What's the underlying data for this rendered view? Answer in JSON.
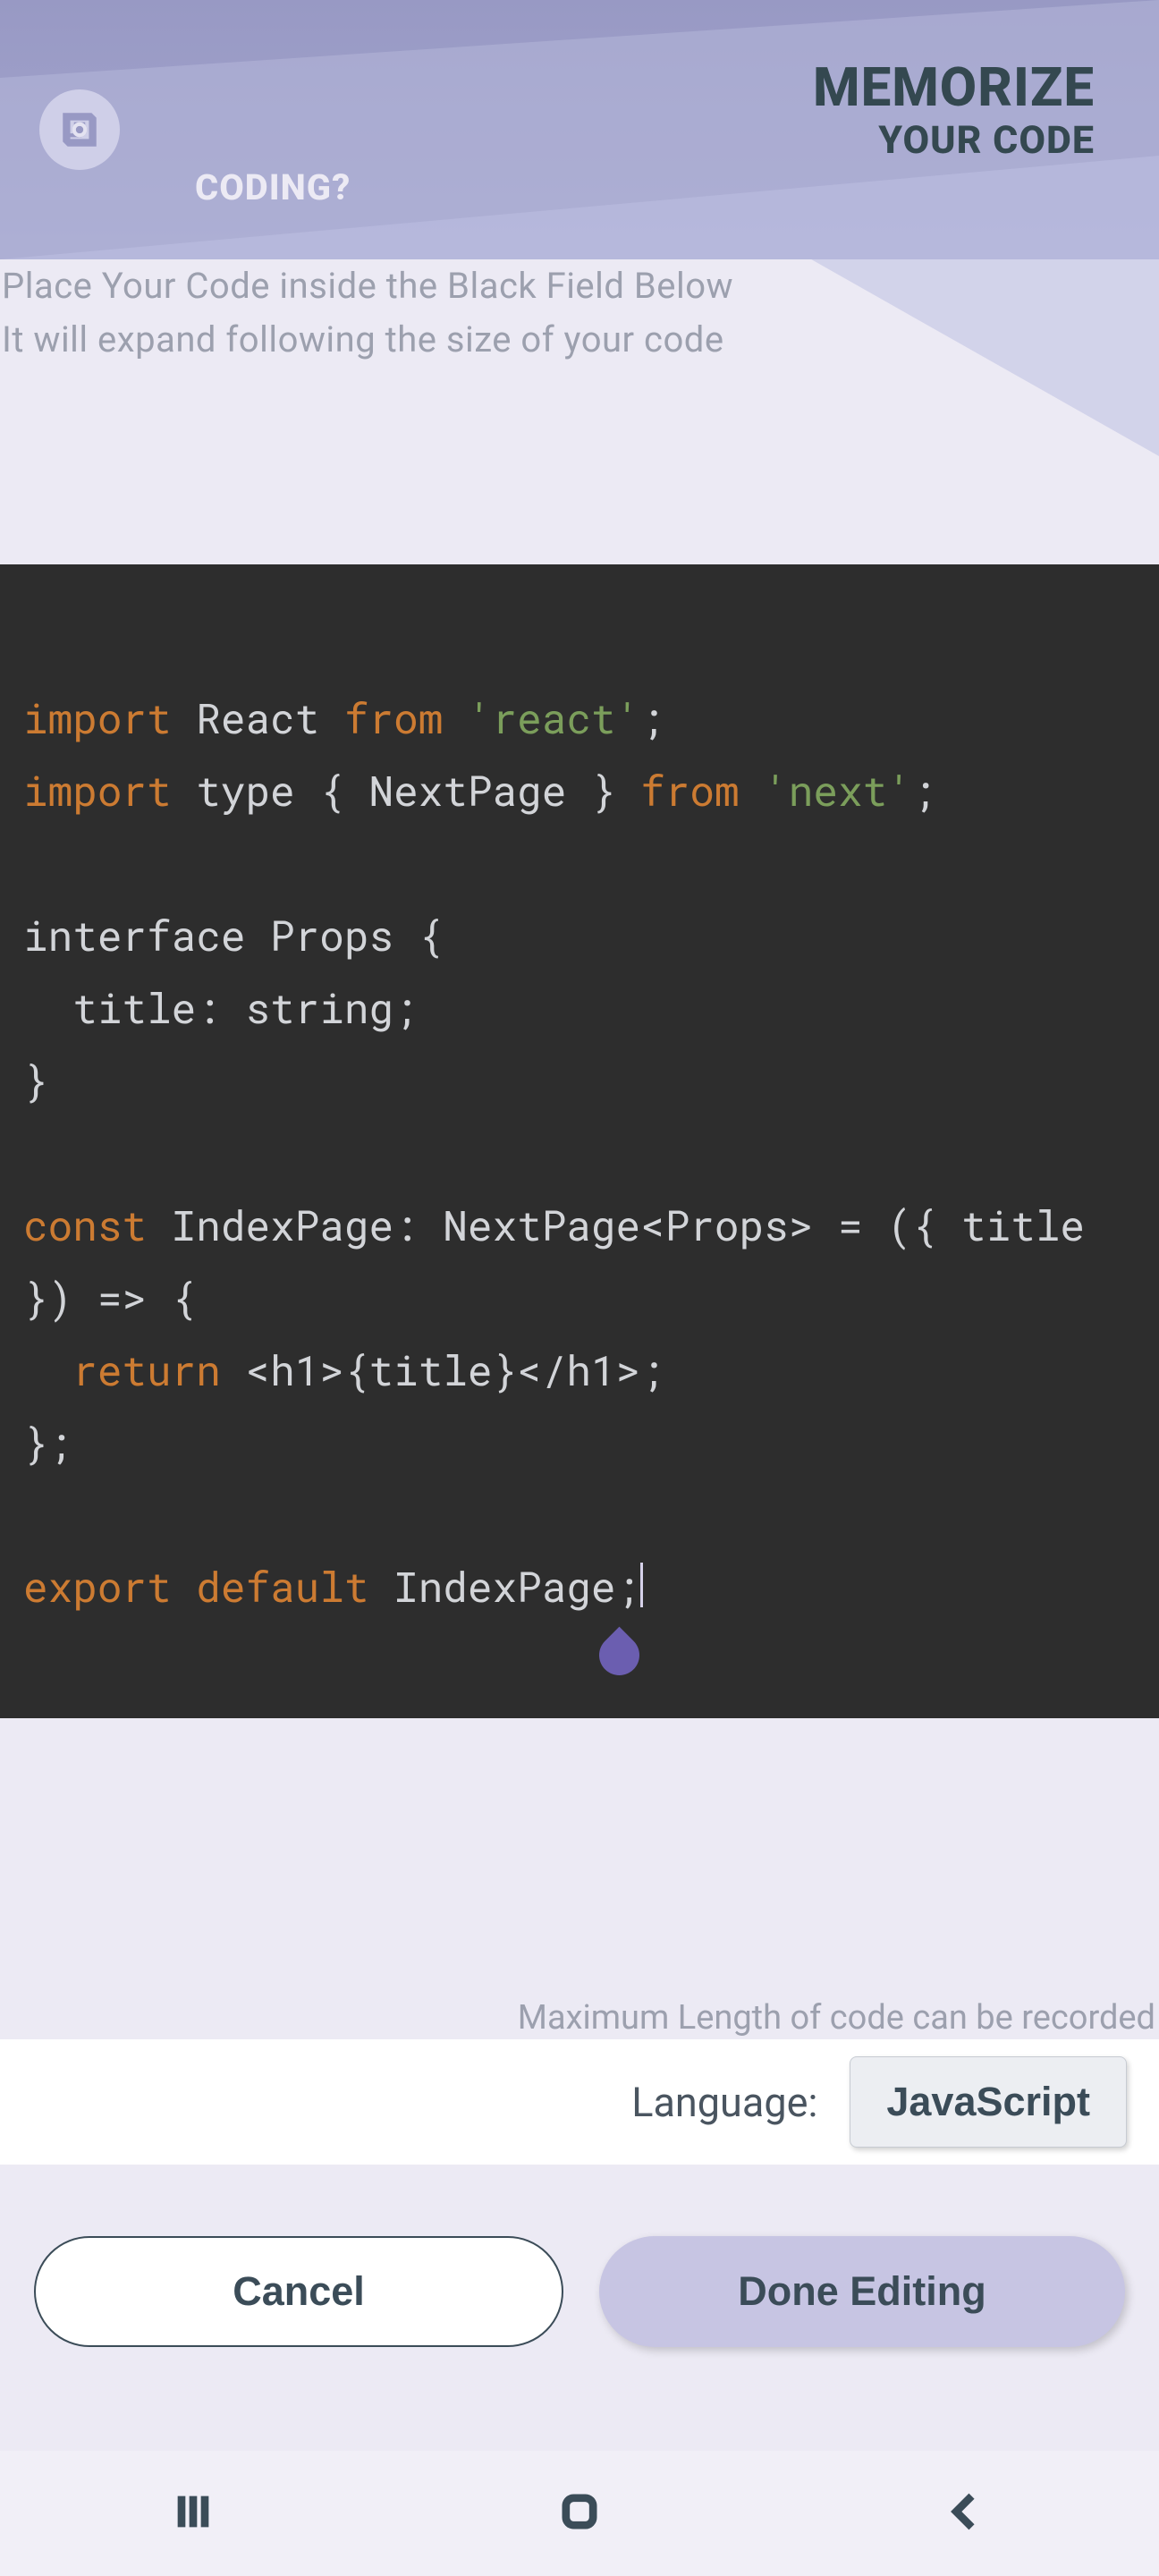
{
  "header": {
    "brand_question": "CODING?",
    "title_line1": "MEMORIZE",
    "title_line2": "YOUR CODE"
  },
  "hints": {
    "line1": "Place Your Code inside the Black Field Below",
    "line2": "It will expand following the size of your code"
  },
  "code": {
    "tokens": [
      {
        "t": "kw",
        "v": "import"
      },
      {
        "t": "txt",
        "v": " React "
      },
      {
        "t": "kw",
        "v": "from"
      },
      {
        "t": "txt",
        "v": " "
      },
      {
        "t": "str",
        "v": "'react'"
      },
      {
        "t": "txt",
        "v": ";\n"
      },
      {
        "t": "kw",
        "v": "import"
      },
      {
        "t": "txt",
        "v": " type { NextPage } "
      },
      {
        "t": "kw",
        "v": "from"
      },
      {
        "t": "txt",
        "v": " "
      },
      {
        "t": "str",
        "v": "'next'"
      },
      {
        "t": "txt",
        "v": ";\n"
      },
      {
        "t": "txt",
        "v": "\n"
      },
      {
        "t": "txt",
        "v": "interface Props {\n"
      },
      {
        "t": "txt",
        "v": "  title: string;\n"
      },
      {
        "t": "txt",
        "v": "}\n"
      },
      {
        "t": "txt",
        "v": "\n"
      },
      {
        "t": "kw",
        "v": "const"
      },
      {
        "t": "txt",
        "v": " IndexPage: NextPage<Props> = ({ title }) => {\n"
      },
      {
        "t": "txt",
        "v": "  "
      },
      {
        "t": "kw",
        "v": "return"
      },
      {
        "t": "txt",
        "v": " <h1>{title}</h1>;\n"
      },
      {
        "t": "txt",
        "v": "};\n"
      },
      {
        "t": "txt",
        "v": "\n"
      },
      {
        "t": "kw",
        "v": "export"
      },
      {
        "t": "txt",
        "v": " "
      },
      {
        "t": "kw",
        "v": "default"
      },
      {
        "t": "txt",
        "v": " IndexPage;"
      }
    ]
  },
  "footer": {
    "maxlen": "Maximum Length of code can be recorded",
    "language_label": "Language:",
    "language_value": "JavaScript",
    "cancel": "Cancel",
    "done": "Done Editing"
  },
  "colors": {
    "accent": "#6b5eb0",
    "keyword": "#cc7b32",
    "string": "#7b9e5b",
    "editor_bg": "#2d2d2d"
  }
}
